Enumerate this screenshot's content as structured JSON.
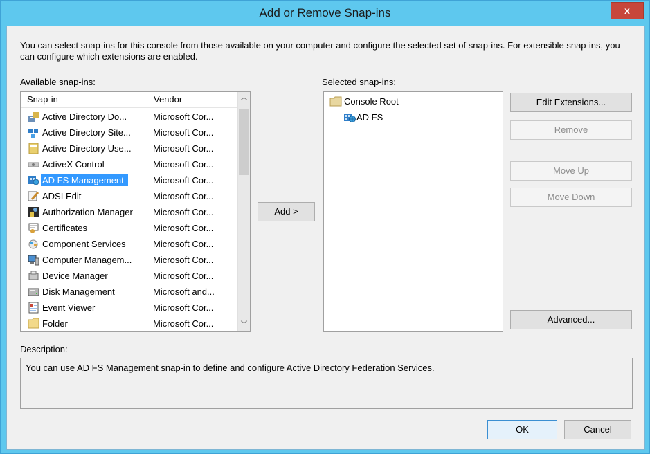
{
  "window": {
    "title": "Add or Remove Snap-ins",
    "close_label": "x"
  },
  "intro": "You can select snap-ins for this console from those available on your computer and configure the selected set of snap-ins. For extensible snap-ins, you can configure which extensions are enabled.",
  "available": {
    "label": "Available snap-ins:",
    "columns": [
      "Snap-in",
      "Vendor"
    ],
    "rows": [
      {
        "name": "Active Directory Do...",
        "vendor": "Microsoft Cor...",
        "icon": "active-directory-domains-icon"
      },
      {
        "name": "Active Directory Site...",
        "vendor": "Microsoft Cor...",
        "icon": "active-directory-sites-icon"
      },
      {
        "name": "Active Directory Use...",
        "vendor": "Microsoft Cor...",
        "icon": "active-directory-users-icon"
      },
      {
        "name": "ActiveX Control",
        "vendor": "Microsoft Cor...",
        "icon": "activex-control-icon"
      },
      {
        "name": "AD FS Management",
        "vendor": "Microsoft Cor...",
        "icon": "adfs-icon",
        "selected": true
      },
      {
        "name": "ADSI Edit",
        "vendor": "Microsoft Cor...",
        "icon": "adsi-edit-icon"
      },
      {
        "name": "Authorization Manager",
        "vendor": "Microsoft Cor...",
        "icon": "authorization-manager-icon"
      },
      {
        "name": "Certificates",
        "vendor": "Microsoft Cor...",
        "icon": "certificates-icon"
      },
      {
        "name": "Component Services",
        "vendor": "Microsoft Cor...",
        "icon": "component-services-icon"
      },
      {
        "name": "Computer Managem...",
        "vendor": "Microsoft Cor...",
        "icon": "computer-management-icon"
      },
      {
        "name": "Device Manager",
        "vendor": "Microsoft Cor...",
        "icon": "device-manager-icon"
      },
      {
        "name": "Disk Management",
        "vendor": "Microsoft and...",
        "icon": "disk-management-icon"
      },
      {
        "name": "Event Viewer",
        "vendor": "Microsoft Cor...",
        "icon": "event-viewer-icon"
      },
      {
        "name": "Folder",
        "vendor": "Microsoft Cor...",
        "icon": "folder-icon"
      }
    ]
  },
  "add_button": "Add >",
  "selected": {
    "label": "Selected snap-ins:",
    "root": "Console Root",
    "child": "AD FS"
  },
  "buttons": {
    "edit_extensions": "Edit Extensions...",
    "remove": "Remove",
    "move_up": "Move Up",
    "move_down": "Move Down",
    "advanced": "Advanced...",
    "ok": "OK",
    "cancel": "Cancel"
  },
  "description": {
    "label": "Description:",
    "text": "You can use AD FS Management snap-in to define and configure Active Directory Federation Services."
  },
  "colors": {
    "titlebar": "#5ec8ee",
    "selection": "#3399ff",
    "close": "#c7463a"
  }
}
